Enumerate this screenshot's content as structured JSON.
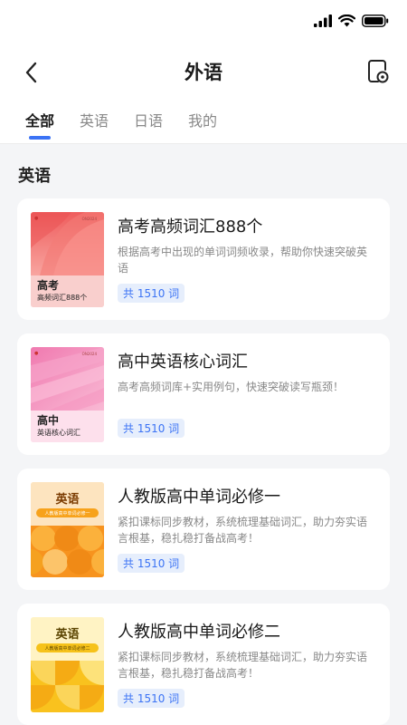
{
  "header": {
    "title": "外语"
  },
  "tabs": [
    {
      "label": "全部",
      "active": true
    },
    {
      "label": "英语",
      "active": false
    },
    {
      "label": "日语",
      "active": false
    },
    {
      "label": "我的",
      "active": false
    }
  ],
  "section": {
    "title": "英语"
  },
  "books": [
    {
      "title": "高考高频词汇888个",
      "desc": "根据高考中出现的单词词频收录，帮助你快速突破英语",
      "count": "共 1510 词",
      "cover": {
        "title": "高考",
        "sub": "高频词汇888个",
        "tag": "ON2024"
      }
    },
    {
      "title": "高中英语核心词汇",
      "desc": "高考高频词库+实用例句，快速突破读写瓶颈！",
      "count": "共 1510 词",
      "cover": {
        "title": "高中",
        "sub": "英语核心词汇",
        "tag": "ON2024"
      }
    },
    {
      "title": "人教版高中单词必修一",
      "desc": "紧扣课标同步教材，系统梳理基础词汇，助力夯实语言根基，稳扎稳打备战高考！",
      "count": "共 1510 词",
      "cover": {
        "title": "英语",
        "sub": "人教版高中单词必修一"
      }
    },
    {
      "title": "人教版高中单词必修二",
      "desc": "紧扣课标同步教材，系统梳理基础词汇，助力夯实语言根基，稳扎稳打备战高考！",
      "count": "共 1510 词",
      "cover": {
        "title": "英语",
        "sub": "人教版高中单词必修二"
      }
    }
  ],
  "colors": {
    "accent": "#3b73f5",
    "badge_bg": "#e6eefc"
  }
}
